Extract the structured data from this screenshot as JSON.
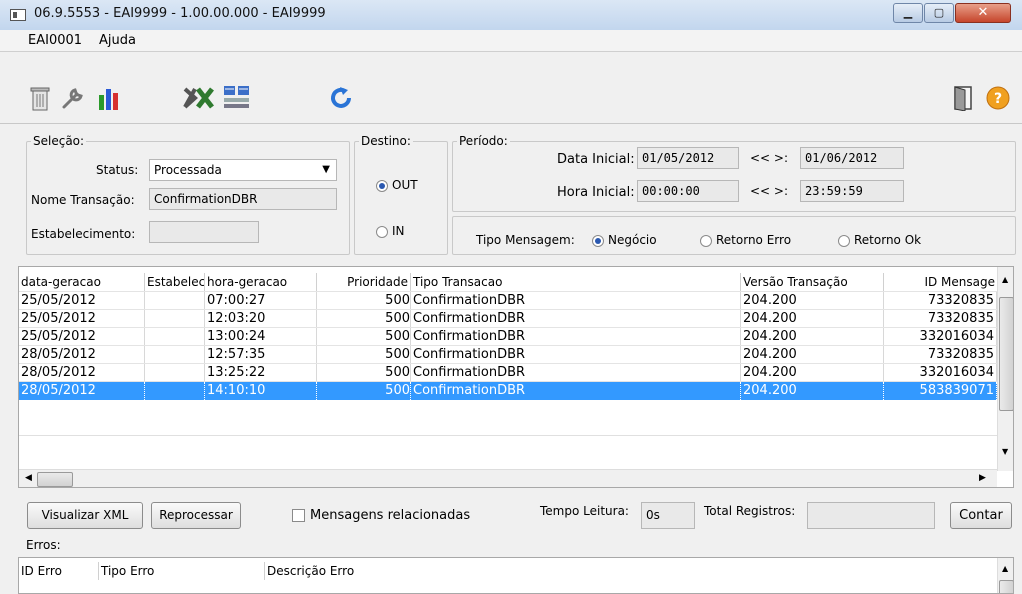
{
  "window": {
    "title": "06.9.5553 - EAI9999 - 1.00.00.000 - EAI9999"
  },
  "menu": [
    "EAI0001",
    "Ajuda"
  ],
  "toolbar": {
    "icons": [
      "trash-icon",
      "wrench-icon",
      "bar-chart-icon",
      "excel-icon",
      "grid-icon",
      "refresh-icon",
      "exit-door-icon",
      "help-icon"
    ]
  },
  "selecao": {
    "legend": "Seleção:",
    "status_label": "Status:",
    "status_value": "Processada",
    "nome_label": "Nome Transação:",
    "nome_value": "ConfirmationDBR",
    "estab_label": "Estabelecimento:",
    "estab_value": ""
  },
  "destino": {
    "legend": "Destino:",
    "out_label": "OUT",
    "in_label": "IN",
    "selected": "OUT"
  },
  "periodo": {
    "legend": "Período:",
    "data_label": "Data Inicial:",
    "data_inicial": "01/05/2012",
    "data_final": "01/06/2012",
    "hora_label": "Hora Inicial:",
    "hora_inicial": "00:00:00",
    "hora_final": "23:59:59",
    "arrows": "<<  >:"
  },
  "tipo_mensagem": {
    "label": "Tipo Mensagem:",
    "options": [
      "Negócio",
      "Retorno Erro",
      "Retorno Ok"
    ],
    "selected": "Negócio"
  },
  "table": {
    "columns": [
      "data-geracao",
      "Estabelec",
      "hora-geracao",
      "Prioridade",
      "Tipo Transacao",
      "Versão Transação",
      "ID Mensage"
    ],
    "rows": [
      [
        "25/05/2012",
        "",
        "07:00:27",
        "500",
        "ConfirmationDBR",
        "204.200",
        "73320835"
      ],
      [
        "25/05/2012",
        "",
        "12:03:20",
        "500",
        "ConfirmationDBR",
        "204.200",
        "73320835"
      ],
      [
        "25/05/2012",
        "",
        "13:00:24",
        "500",
        "ConfirmationDBR",
        "204.200",
        "332016034"
      ],
      [
        "28/05/2012",
        "",
        "12:57:35",
        "500",
        "ConfirmationDBR",
        "204.200",
        "73320835"
      ],
      [
        "28/05/2012",
        "",
        "13:25:22",
        "500",
        "ConfirmationDBR",
        "204.200",
        "332016034"
      ],
      [
        "28/05/2012",
        "",
        "14:10:10",
        "500",
        "ConfirmationDBR",
        "204.200",
        "583839071"
      ]
    ],
    "selected_row": 5
  },
  "actions": {
    "visualizar": "Visualizar XML",
    "reprocessar": "Reprocessar",
    "mensagens": "Mensagens relacionadas",
    "tempo_label": "Tempo Leitura:",
    "tempo_value": "0s",
    "total_label": "Total Registros:",
    "total_value": "",
    "contar": "Contar"
  },
  "erros": {
    "label": "Erros:",
    "columns": [
      "ID Erro",
      "Tipo Erro",
      "Descrição Erro"
    ]
  }
}
